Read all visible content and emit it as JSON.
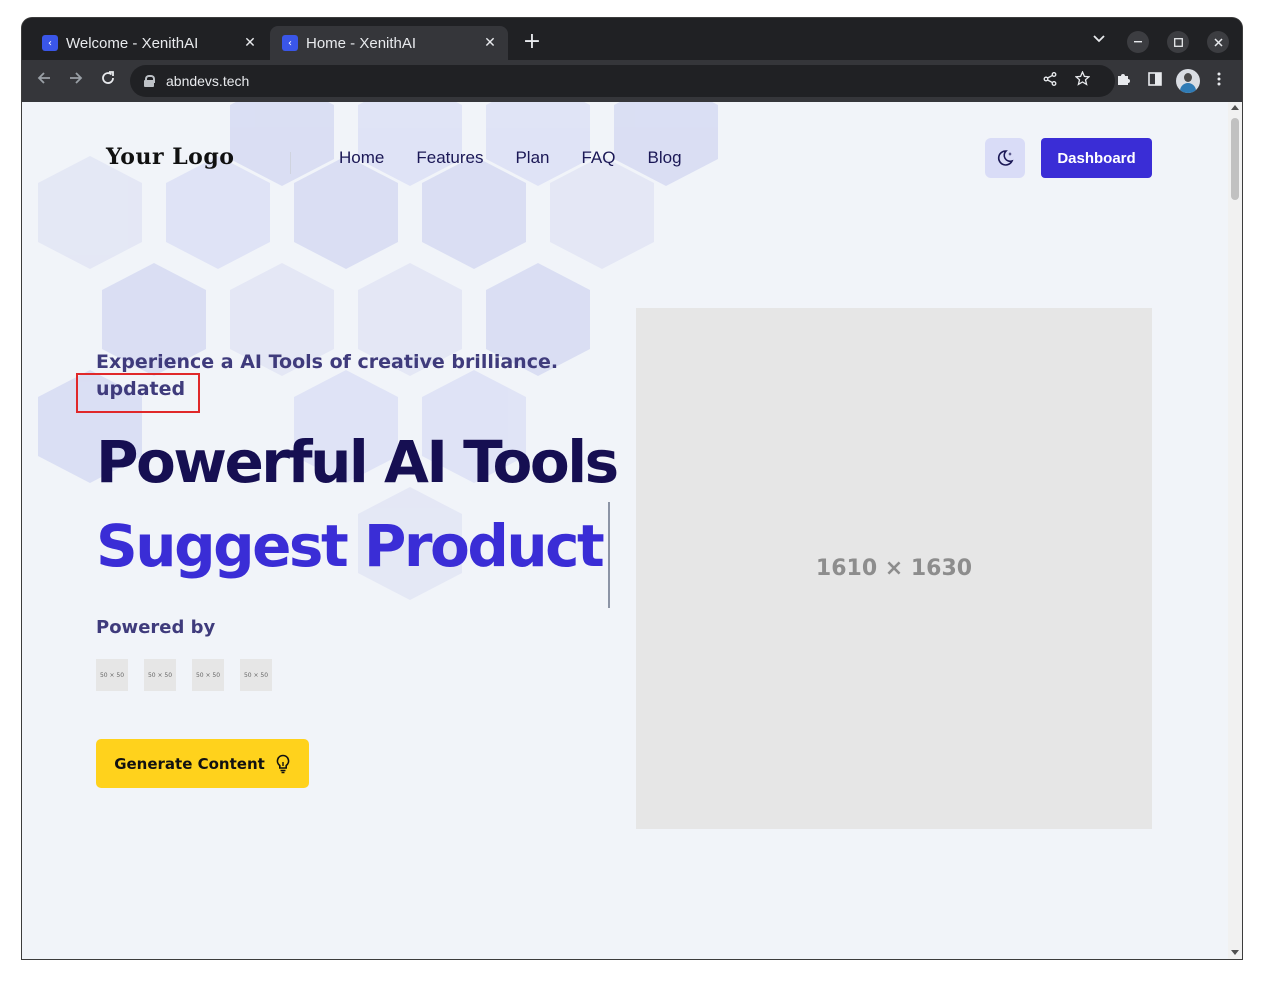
{
  "browser": {
    "tabs": [
      {
        "title": "Welcome - XenithAI",
        "close": "✕",
        "active": false
      },
      {
        "title": "Home - XenithAI",
        "close": "✕",
        "active": true
      }
    ],
    "new_tab": "+",
    "url": "abndevs.tech"
  },
  "site": {
    "logo": "Your Logo",
    "nav": [
      "Home",
      "Features",
      "Plan",
      "FAQ",
      "Blog"
    ],
    "dashboard_label": "Dashboard",
    "accent_color": "#3a2dd6",
    "cta_color": "#ffd21c"
  },
  "hero": {
    "tagline": "Experience a AI Tools of creative brilliance. updated",
    "headline_1": "Powerful AI Tools",
    "headline_2": "Suggest Product",
    "powered_by": "Powered by",
    "partner_logos": [
      "50 × 50",
      "50 × 50",
      "50 × 50",
      "50 × 50"
    ],
    "cta_label": "Generate Content",
    "image_placeholder": "1610 × 1630"
  }
}
